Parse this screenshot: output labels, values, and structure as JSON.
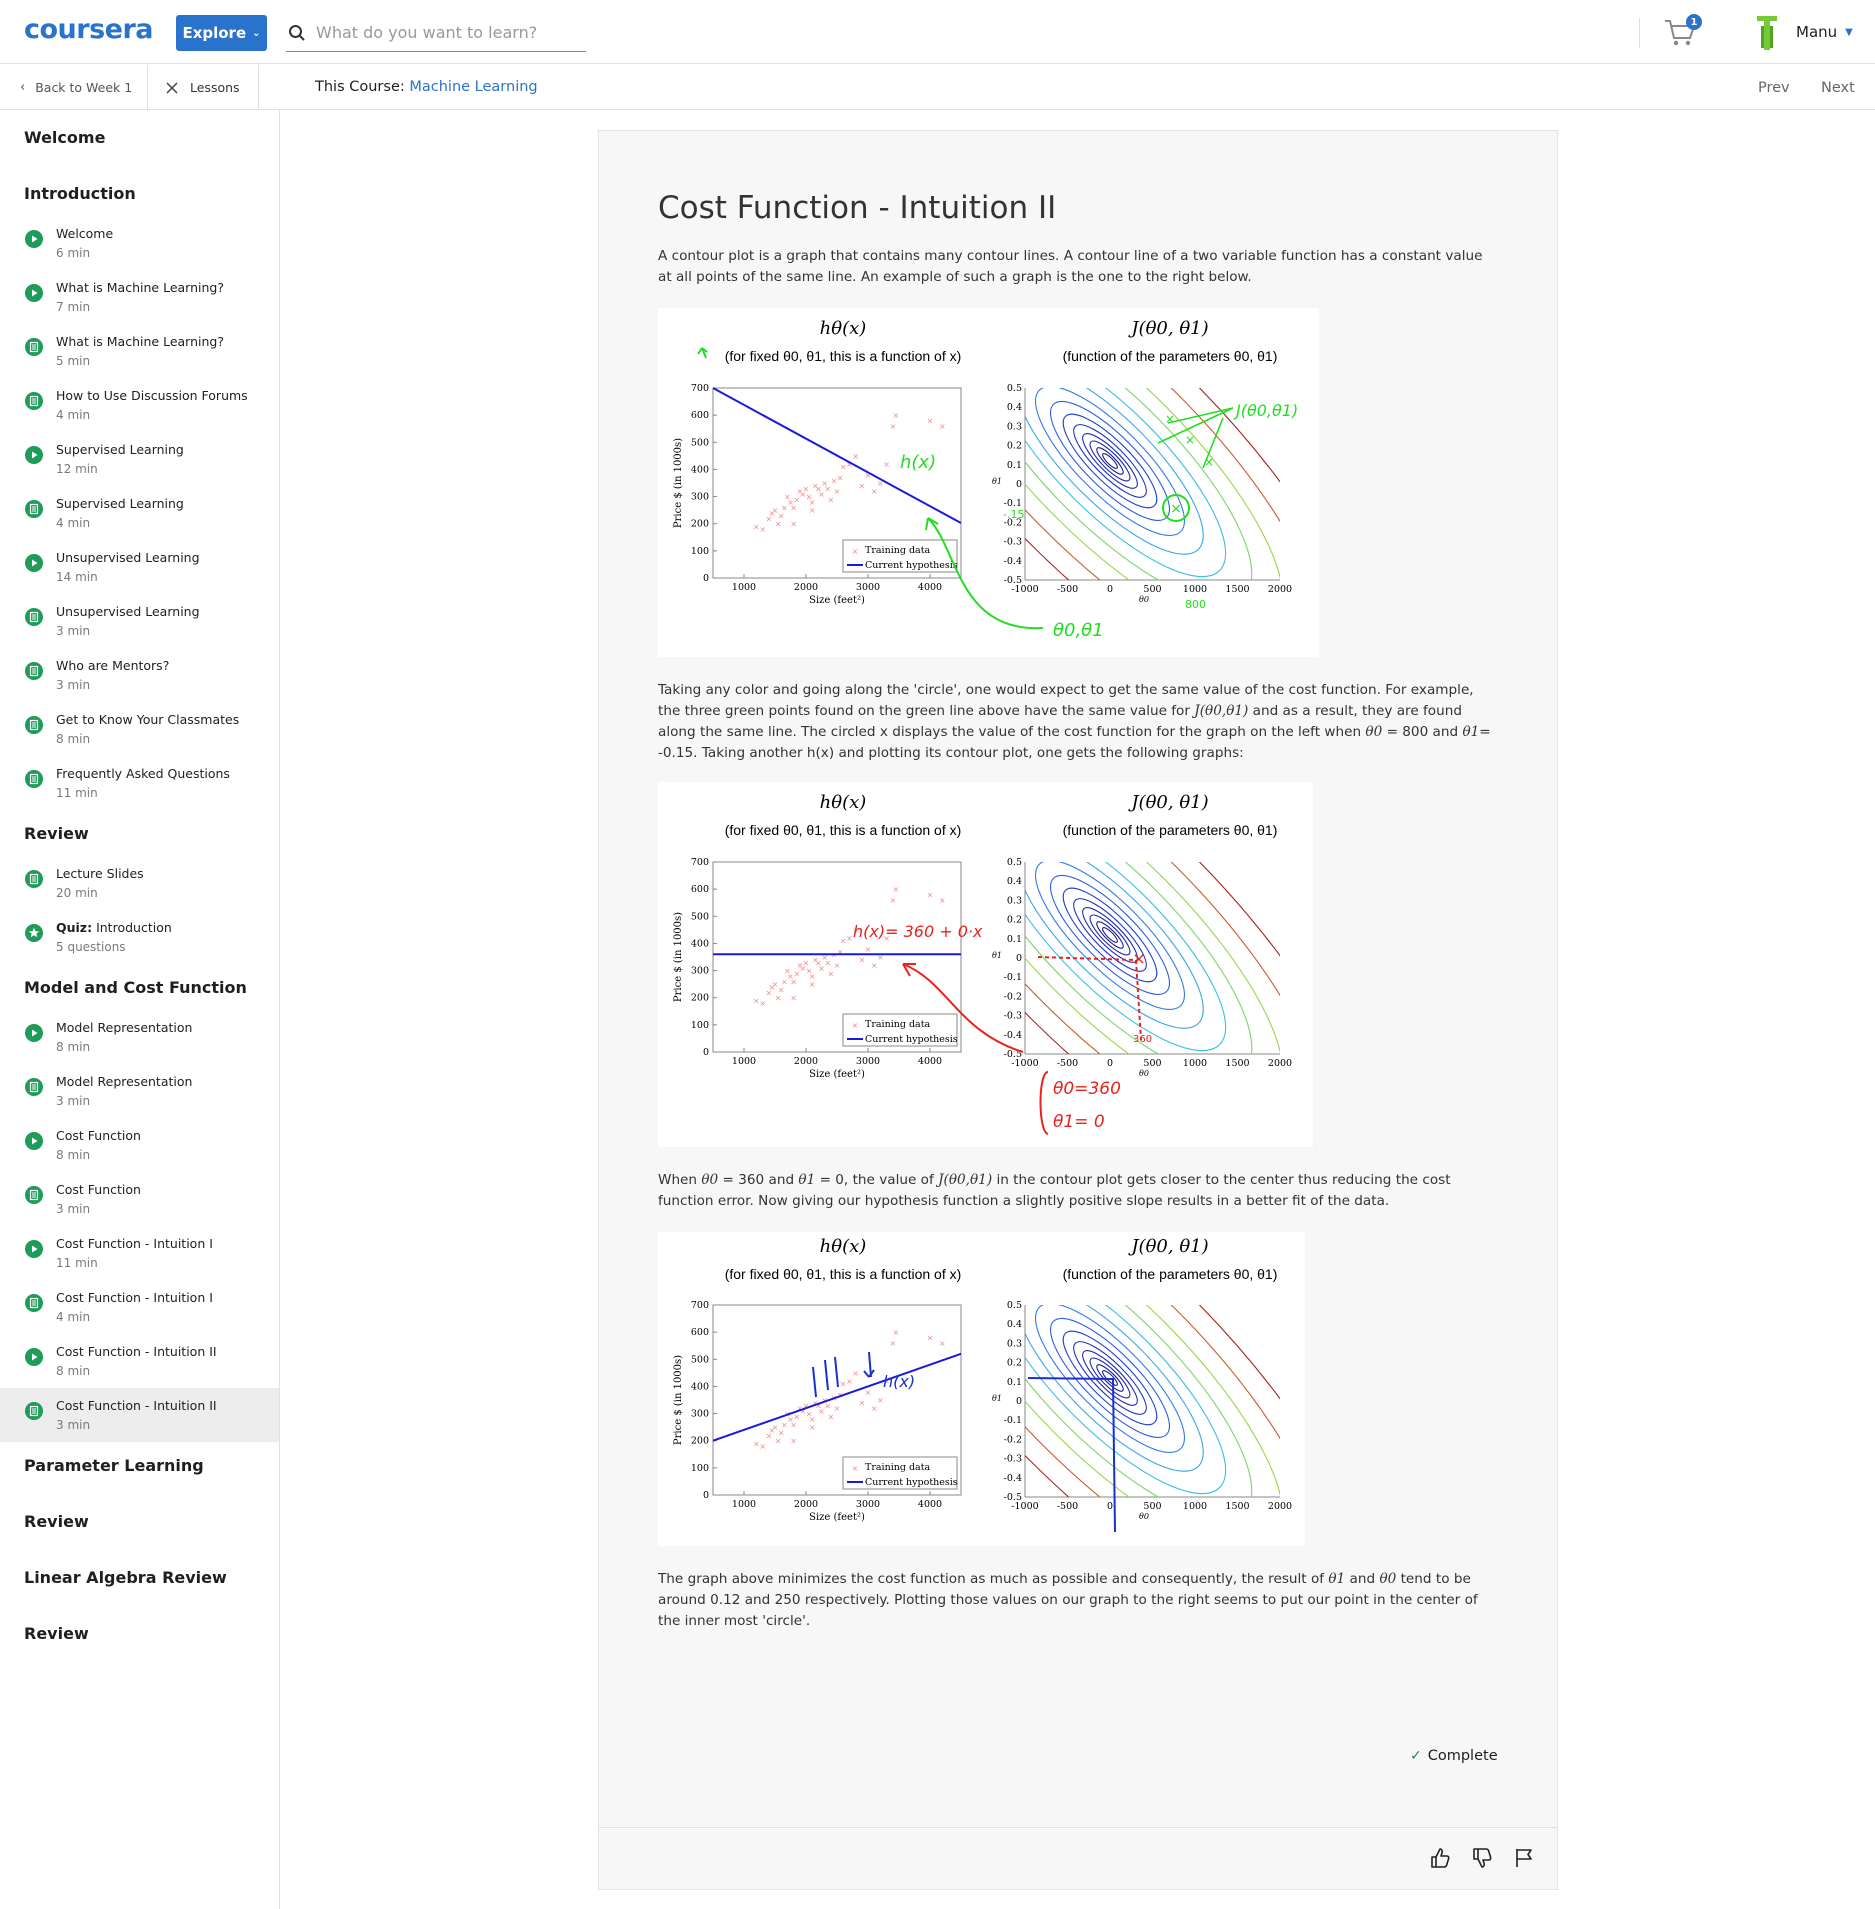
{
  "header": {
    "logo": "coursera",
    "explore_label": "Explore",
    "search_placeholder": "What do you want to learn?",
    "cart_count": "1",
    "user_name": "Manu"
  },
  "nav": {
    "back_label": "Back to Week 1",
    "lessons_label": "Lessons",
    "course_prefix": "This Course:",
    "course_name": "Machine Learning",
    "prev_label": "Prev",
    "next_label": "Next"
  },
  "sidebar": {
    "sections": [
      {
        "title": "Welcome",
        "items": []
      },
      {
        "title": "Introduction",
        "items": [
          {
            "label": "Welcome",
            "duration": "6 min",
            "icon": "play-icon"
          },
          {
            "label": "What is Machine Learning?",
            "duration": "7 min",
            "icon": "play-icon"
          },
          {
            "label": "What is Machine Learning?",
            "duration": "5 min",
            "icon": "reading-icon"
          },
          {
            "label": "How to Use Discussion Forums",
            "duration": "4 min",
            "icon": "reading-icon"
          },
          {
            "label": "Supervised Learning",
            "duration": "12 min",
            "icon": "play-icon"
          },
          {
            "label": "Supervised Learning",
            "duration": "4 min",
            "icon": "reading-icon"
          },
          {
            "label": "Unsupervised Learning",
            "duration": "14 min",
            "icon": "play-icon"
          },
          {
            "label": "Unsupervised Learning",
            "duration": "3 min",
            "icon": "reading-icon"
          },
          {
            "label": "Who are Mentors?",
            "duration": "3 min",
            "icon": "reading-icon"
          },
          {
            "label": "Get to Know Your Classmates",
            "duration": "8 min",
            "icon": "reading-icon"
          },
          {
            "label": "Frequently Asked Questions",
            "duration": "11 min",
            "icon": "reading-icon"
          }
        ]
      },
      {
        "title": "Review",
        "items": [
          {
            "label": "Lecture Slides",
            "duration": "20 min",
            "icon": "reading-icon"
          },
          {
            "label_prefix": "Quiz:",
            "label": "Introduction",
            "duration": "5 questions",
            "icon": "quiz-icon"
          }
        ]
      },
      {
        "title": "Model and Cost Function",
        "items": [
          {
            "label": "Model Representation",
            "duration": "8 min",
            "icon": "play-icon"
          },
          {
            "label": "Model Representation",
            "duration": "3 min",
            "icon": "reading-icon"
          },
          {
            "label": "Cost Function",
            "duration": "8 min",
            "icon": "play-icon"
          },
          {
            "label": "Cost Function",
            "duration": "3 min",
            "icon": "reading-icon"
          },
          {
            "label": "Cost Function - Intuition I",
            "duration": "11 min",
            "icon": "play-icon"
          },
          {
            "label": "Cost Function - Intuition I",
            "duration": "4 min",
            "icon": "reading-icon"
          },
          {
            "label": "Cost Function - Intuition II",
            "duration": "8 min",
            "icon": "play-icon"
          },
          {
            "label": "Cost Function - Intuition II",
            "duration": "3 min",
            "icon": "reading-icon",
            "active": true
          }
        ]
      },
      {
        "title": "Parameter Learning",
        "items": []
      },
      {
        "title": "Review",
        "items": []
      },
      {
        "title": "Linear Algebra Review",
        "items": []
      },
      {
        "title": "Review",
        "items": []
      }
    ]
  },
  "content": {
    "title": "Cost Function - Intuition II",
    "p1": "A contour plot is a graph that contains many contour lines. A contour line of a two variable function has a constant value at all points of the same line. An example of such a graph is the one to the right below.",
    "p2a": "Taking any color and going along the 'circle', one would expect to get the same value of the cost function. For example, the three green points found on the green line above have the same value for ",
    "p2_math": "J(θ0,θ1)",
    "p2b": " and as a result, they are found along the same line. The circled x displays the value of the cost function for the graph on the left when ",
    "p2_theta0": "θ0",
    "p2c": " = 800 and ",
    "p2_theta1": "θ1",
    "p2d": "= -0.15. Taking another h(x) and plotting its contour plot, one gets the following graphs:",
    "p3a": "When ",
    "p3_theta0": "θ0",
    "p3b": " = 360 and ",
    "p3_theta1": "θ1",
    "p3c": " = 0, the value of ",
    "p3_math": "J(θ0,θ1)",
    "p3d": " in the contour plot gets closer to the center thus reducing the cost function error. Now giving our hypothesis function a slightly positive slope results in a better fit of the data.",
    "p4a": "The graph above minimizes the cost function as much as possible and consequently, the result of ",
    "p4_theta1": "θ1",
    "p4b": " and ",
    "p4_theta0": "θ0",
    "p4c": " tend to be around 0.12 and 250 respectively. Plotting those values on our graph to the right seems to put our point in the center of the inner most 'circle'.",
    "complete_label": "Complete"
  },
  "figures": {
    "left_title": "hθ(x)",
    "left_subtitle": "(for fixed θ0, θ1, this is a function of x)",
    "right_title": "J(θ0, θ1)",
    "right_subtitle": "(function of the parameters θ0, θ1)",
    "y_label": "Price $ (in 1000s)",
    "x_label": "Size (feet²)",
    "legend_training": "Training data",
    "legend_hypothesis": "Current hypothesis",
    "right_xlabel": "θ0",
    "right_ylabel": "θ1",
    "left_yticks": [
      "0",
      "100",
      "200",
      "300",
      "400",
      "500",
      "600",
      "700"
    ],
    "left_xticks": [
      "1000",
      "2000",
      "3000",
      "4000"
    ],
    "right_yticks": [
      "-0.5",
      "-0.4",
      "-0.3",
      "-0.2",
      "-0.1",
      "0",
      "0.1",
      "0.2",
      "0.3",
      "0.4",
      "0.5"
    ],
    "right_xticks": [
      "-1000",
      "-500",
      "0",
      "500",
      "1000",
      "1500",
      "2000"
    ],
    "annotations_1": [
      "J(θ0,θ1)",
      "h(x)",
      "θ0,θ1",
      "-.15",
      "800"
    ],
    "annotations_2": [
      "h(x)= 360 + 0·x",
      "θ0=360",
      "θ1= 0",
      "360"
    ],
    "annotations_3": [
      "h(x)"
    ],
    "colors": {
      "hypothesis": "#1a1adf",
      "training": "#f08a8a",
      "annot_green": "#22dd22",
      "annot_red": "#e8231c",
      "annot_blue": "#1a2fd0"
    }
  }
}
